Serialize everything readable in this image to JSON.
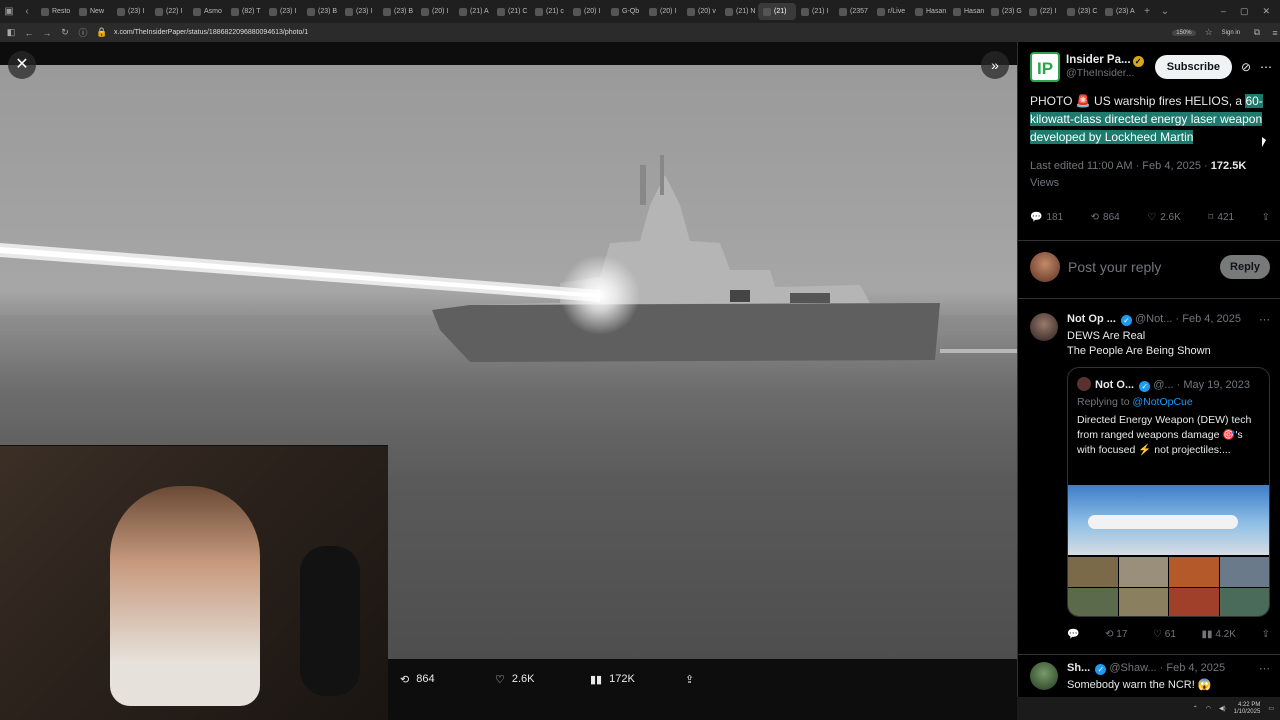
{
  "browser": {
    "tabs": [
      "Resto",
      "New",
      "(23) I",
      "(22) I",
      "Asmo",
      "(82) T",
      "(23) I",
      "(23) B",
      "(23) I",
      "(23) B",
      "(20) I",
      "(21) A",
      "(21) C",
      "(21) c",
      "(20) I",
      "G-Qb",
      "(20) I",
      "(20) v",
      "(21) N",
      "(21)",
      "(21) I",
      "(2357",
      "r/Live",
      "Hasan",
      "Hasan",
      "(23) G",
      "(22) I",
      "(23) C",
      "(23) A"
    ],
    "url": "x.com/TheInsiderPaper/status/1886822096880094613/photo/1",
    "zoom": "150%",
    "signin_label": "Sign in"
  },
  "photo": {
    "actions": {
      "retweets": "864",
      "likes": "2.6K",
      "views": "172K"
    }
  },
  "tweet": {
    "author_name": "Insider Pa...",
    "author_handle": "@TheInsider...",
    "logo_text": "IP",
    "subscribe_label": "Subscribe",
    "text_plain": "PHOTO 🚨 US warship fires HELIOS, a ",
    "text_highlight": "60-kilowatt-class directed energy laser weapon developed by Lockheed Martin",
    "edited": "Last edited 11:00 AM · Feb 4, 2025 · ",
    "views_count": "172.5K",
    "views_label": "Views",
    "stats": {
      "replies": "181",
      "retweets": "864",
      "likes": "2.6K",
      "bookmarks": "421"
    },
    "reply_placeholder": "Post your reply",
    "reply_button": "Reply"
  },
  "replies": [
    {
      "name": "Not Op ...",
      "handle": "@Not...",
      "date": "· Feb 4, 2025",
      "line1": "DEWS Are Real",
      "line2": "The People Are Being Shown",
      "quote": {
        "name": "Not O...",
        "handle": "@...",
        "date": "· May 19, 2023",
        "replying_prefix": "Replying to ",
        "replying_to": "@NotOpCue",
        "text": "Directed Energy Weapon (DEW) tech from ranged weapons damage 🎯's with focused ⚡ not projectiles:..."
      },
      "actions": {
        "retweets": "17",
        "likes": "61",
        "views": "4.2K"
      }
    },
    {
      "name": "Sh...",
      "handle": "@Shaw...",
      "date": "· Feb 4, 2025",
      "line1": "Somebody warn the NCR! 😱"
    }
  ],
  "taskbar": {
    "time": "4:22 PM",
    "date": "1/10/2025"
  }
}
